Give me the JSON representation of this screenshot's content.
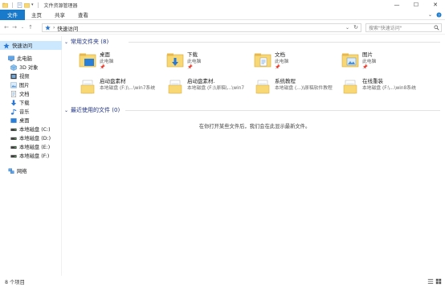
{
  "window": {
    "title": "文件资源管理器"
  },
  "ribbon": {
    "tabs": [
      {
        "label": "文件",
        "active": true
      },
      {
        "label": "主页"
      },
      {
        "label": "共享"
      },
      {
        "label": "查看"
      }
    ]
  },
  "address": {
    "path": [
      "快速访问"
    ],
    "search_placeholder": "搜索\"快速访问\""
  },
  "sidebar": {
    "items": [
      {
        "label": "快速访问",
        "icon": "star-icon",
        "selected": true
      },
      {
        "label": "此电脑",
        "icon": "computer-icon"
      },
      {
        "label": "3D 对象",
        "icon": "cube-icon"
      },
      {
        "label": "视频",
        "icon": "video-icon"
      },
      {
        "label": "图片",
        "icon": "pictures-icon"
      },
      {
        "label": "文档",
        "icon": "document-icon"
      },
      {
        "label": "下载",
        "icon": "download-icon"
      },
      {
        "label": "音乐",
        "icon": "music-icon"
      },
      {
        "label": "桌面",
        "icon": "desktop-icon"
      },
      {
        "label": "本地磁盘 (C:)",
        "icon": "drive-icon"
      },
      {
        "label": "本地磁盘 (D:)",
        "icon": "drive-icon"
      },
      {
        "label": "本地磁盘 (E:)",
        "icon": "drive-icon"
      },
      {
        "label": "本地磁盘 (F:)",
        "icon": "drive-icon"
      },
      {
        "label": "网络",
        "icon": "network-icon"
      }
    ]
  },
  "frequent": {
    "header": "常用文件夹 (8)",
    "folders": [
      {
        "name": "桌面",
        "sub": "此电脑",
        "icon": "desktop-folder-icon",
        "pinned": true
      },
      {
        "name": "下载",
        "sub": "此电脑",
        "icon": "download-folder-icon",
        "pinned": true
      },
      {
        "name": "文档",
        "sub": "此电脑",
        "icon": "documents-folder-icon",
        "pinned": true
      },
      {
        "name": "图片",
        "sub": "此电脑",
        "icon": "pictures-folder-icon",
        "pinned": true
      },
      {
        "name": "启动盘素材",
        "sub": "本地磁盘 (F:)\\...\\win7系统",
        "icon": "plain-folder-icon",
        "pinned": false
      },
      {
        "name": "启动盘素材.",
        "sub": "本地磁盘 (F:)\\原稿\\...\\win7",
        "icon": "plain-folder-icon",
        "pinned": false
      },
      {
        "name": "系统教程",
        "sub": "本地磁盘 (...)\\原稿软件教程",
        "icon": "plain-folder-icon",
        "pinned": false
      },
      {
        "name": "在线重装",
        "sub": "本地磁盘 (F:\\...\\win8系统",
        "icon": "plain-folder-icon",
        "pinned": false
      }
    ]
  },
  "recent": {
    "header": "最近使用的文件 (0)",
    "empty_message": "在你打开某些文件后，我们会在此显示最新文件。"
  },
  "status": {
    "count": "8 个项目"
  },
  "colors": {
    "accent": "#1979ca",
    "group_header": "#1e3287",
    "selected_bg": "#cce8ff",
    "folder_yellow": "#f8d775"
  }
}
